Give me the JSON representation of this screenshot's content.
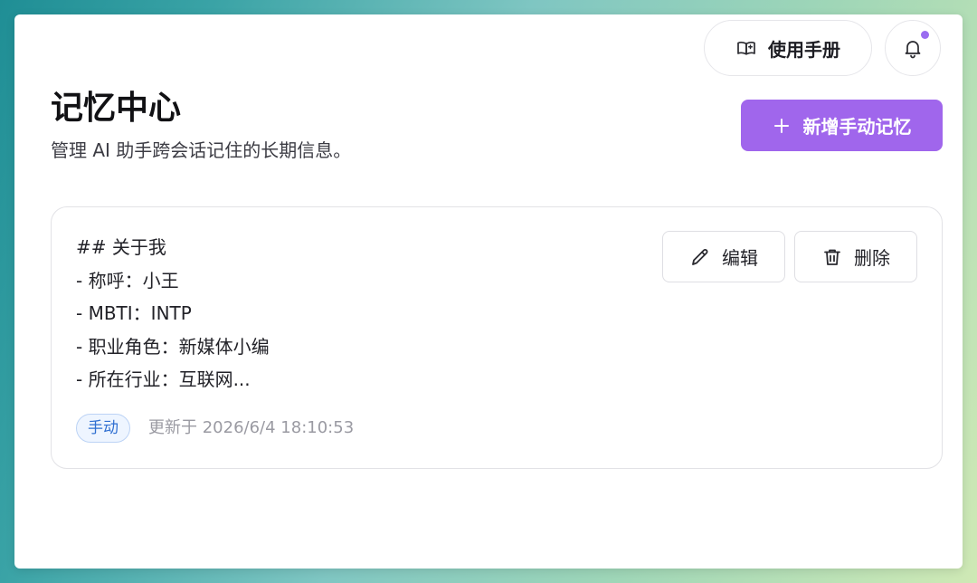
{
  "header": {
    "manual_label": "使用手册",
    "notification_dot_color": "#9a6cf0"
  },
  "page": {
    "title": "记忆中心",
    "subtitle": "管理 AI 助手跨会话记住的长期信息。",
    "add_button_label": "新增手动记忆",
    "accent_color": "#a066ec"
  },
  "memory": {
    "lines": [
      "## 关于我",
      "- 称呼：小王",
      "- MBTI：INTP",
      "- 职业角色：新媒体小编",
      "- 所在行业：互联网..."
    ],
    "edit_label": "编辑",
    "delete_label": "删除",
    "tag": "手动",
    "updated_prefix": "更新于",
    "updated_time": "2026/6/4 18:10:53"
  }
}
